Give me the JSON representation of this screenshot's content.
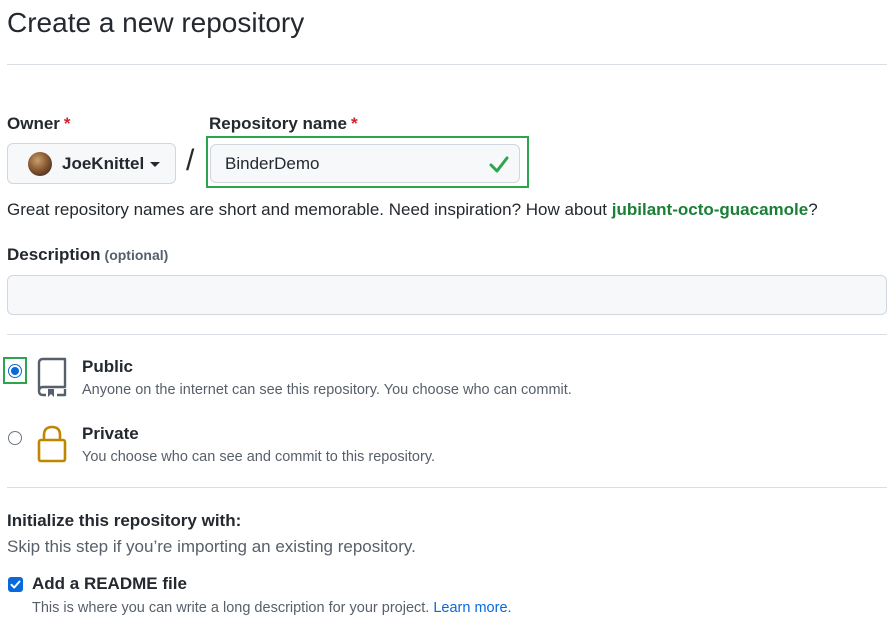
{
  "page": {
    "title": "Create a new repository"
  },
  "owner": {
    "label": "Owner",
    "required_mark": "*",
    "name": "JoeKnittel",
    "avatar_icon": "user-avatar",
    "dropdown_icon": "caret-down-icon"
  },
  "separator": "/",
  "repository": {
    "label": "Repository name",
    "required_mark": "*",
    "value": "BinderDemo",
    "valid_icon": "check-icon"
  },
  "hint": {
    "text": "Great repository names are short and memorable. Need inspiration? How about ",
    "suggestion": "jubilant-octo-guacamole",
    "end": "?"
  },
  "description": {
    "label": "Description",
    "optional": "(optional)",
    "value": ""
  },
  "visibility": {
    "options": [
      {
        "title": "Public",
        "description": "Anyone on the internet can see this repository. You choose who can commit.",
        "icon": "repo-book-icon",
        "selected": true
      },
      {
        "title": "Private",
        "description": "You choose who can see and commit to this repository.",
        "icon": "lock-icon",
        "selected": false
      }
    ]
  },
  "initialize": {
    "title": "Initialize this repository with:",
    "subtitle": "Skip this step if you’re importing an existing repository.",
    "readme": {
      "label": "Add a README file",
      "checked": true,
      "description": "This is where you can write a long description for your project. ",
      "link": "Learn more."
    }
  },
  "colors": {
    "highlight": "#2ea44f",
    "accent": "#0969da",
    "success": "#1a7f37",
    "required": "#cf222e"
  }
}
